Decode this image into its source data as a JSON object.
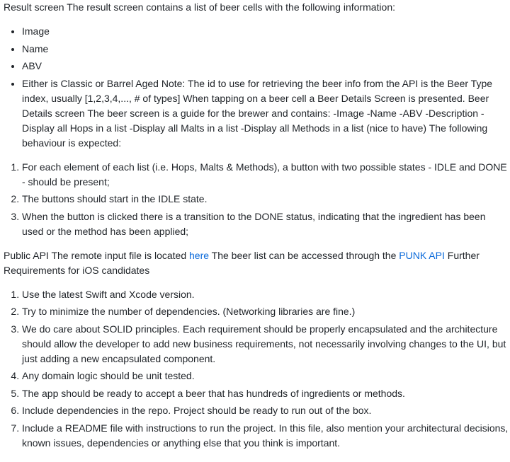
{
  "intro": "Result screen The result screen contains a list of beer cells with the following information:",
  "bullets": [
    "Image",
    "Name",
    "ABV",
    "Either is Classic or Barrel Aged Note: The id to use for retrieving the beer info from the API is the Beer Type index, usually [1,2,3,4,..., # of types] When tapping on a beer cell a Beer Details Screen is presented. Beer Details screen The beer screen is a guide for the brewer and contains: -Image -Name -ABV -Description -Display all Hops in a list -Display all Malts in a list -Display all Methods in a list (nice to have) The following behaviour is expected:"
  ],
  "behaviour": [
    "For each element of each list (i.e. Hops, Malts & Methods), a button with two possible states - IDLE and DONE - should be present;",
    "The buttons should start in the IDLE state.",
    "When the button is clicked there is a transition to the DONE status, indicating that the ingredient has been used or the method has been applied;"
  ],
  "public_api": {
    "text_1": "Public API The remote input file is located ",
    "link_here": "here",
    "text_2": " The beer list can be accessed through the ",
    "link_punk": "PUNK API",
    "text_3": " Further Requirements for iOS candidates"
  },
  "requirements": [
    "Use the latest Swift and Xcode version.",
    "Try to minimize the number of dependencies. (Networking libraries are fine.)",
    "We do care about SOLID principles. Each requirement should be properly encapsulated and the architecture should allow the developer to add new business requirements, not necessarily involving changes to the UI, but just adding a new encapsulated component.",
    "Any domain logic should be unit tested.",
    "The app should be ready to accept a beer that has hundreds of ingredients or methods.",
    "Include dependencies in the repo. Project should be ready to run out of the box.",
    "Include a README file with instructions to run the project. In this file, also mention your architectural decisions, known issues, dependencies or anything else that you think is important."
  ],
  "colors": {
    "text": "#1f2328",
    "link": "#0969da",
    "background": "#ffffff"
  }
}
